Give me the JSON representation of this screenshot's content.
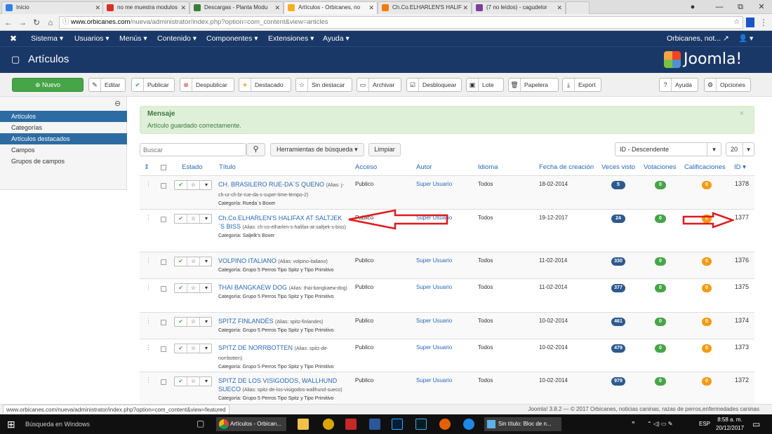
{
  "browser": {
    "tabs": [
      {
        "title": "Inicio",
        "color": "#2f80ed"
      },
      {
        "title": "no me muestra modulos",
        "color": "#d93025"
      },
      {
        "title": "Descargas - Planta Modu",
        "color": "#3a7d3a"
      },
      {
        "title": "Artículos - Orbicanes, no",
        "color": "#f6b01b",
        "active": true
      },
      {
        "title": "Ch.Co.ELHARLEN'S HALIF",
        "color": "#f57c00"
      },
      {
        "title": "(7 no leídos) - cagudelor",
        "color": "#7b3fa1"
      }
    ],
    "url_host": "www.orbicanes.com",
    "url_path": "/nueva/administrator/index.php?option=com_content&view=articles",
    "window": {
      "min": "—",
      "max": "⧉",
      "close": "✕"
    }
  },
  "joomla": {
    "menu": [
      "Sistema ▾",
      "Usuarios ▾",
      "Menús ▾",
      "Contenido ▾",
      "Componentes ▾",
      "Extensiones ▾",
      "Ayuda ▾"
    ],
    "site_name": "Orbicanes, not...",
    "user_label": "▾",
    "page_title": "Artículos",
    "brand": "Joomla!",
    "toolbar": {
      "new": "Nuevo",
      "edit": "Editar",
      "publish": "Publicar",
      "unpublish": "Despublicar",
      "feature": "Destacado",
      "unfeature": "Sin destacar",
      "archive": "Archivar",
      "checkin": "Desbloquear",
      "batch": "Lote",
      "trash": "Papelera",
      "export": "Export",
      "help": "Ayuda",
      "options": "Opciones"
    },
    "sidebar": [
      "Artículos",
      "Categorías",
      "Artículos destacados",
      "Campos",
      "Grupos de campos"
    ],
    "message": {
      "title": "Mensaje",
      "text": "Artículo guardado correctamente."
    },
    "search": {
      "placeholder": "Buscar",
      "tools": "Herramientas de búsqueda ▾",
      "clear": "Limpiar"
    },
    "sort": "ID - Descendente",
    "limit": "20",
    "columns": {
      "status": "Estado",
      "title": "Título",
      "access": "Acceso",
      "author": "Autor",
      "language": "Idioma",
      "date": "Fecha de creación",
      "hits": "Veces visto",
      "votes": "Votaciones",
      "ratings": "Calificaciones",
      "id": "ID ▾"
    },
    "articles": [
      {
        "title": "CH. BRASILERO RUE-DA´S QUENO",
        "alias": "(Alias: j-ch-ur-ch-br-rue-da-s-super-time-tempo-2)",
        "category": "Categoría: Rueda´s Boxer",
        "access": "Publico",
        "author": "Super Usuario",
        "language": "Todos",
        "date": "18-02-2014",
        "hits": "5",
        "votes": "0",
        "rating": "0",
        "id": "1378"
      },
      {
        "title": "Ch.Co.ELHARLEN'S HALIFAX AT SALTJEK `S BISS",
        "alias": "(Alias: ch-co-elharlen-s-halifax-at-saltjek-s-biss)",
        "category": "Categoría: Saljelk's Boxer",
        "access": "Publico",
        "author": "Super Usuario",
        "language": "Todos",
        "date": "19-12-2017",
        "hits": "24",
        "votes": "0",
        "rating": "0",
        "id": "1377"
      },
      {
        "title": "VOLPINO ITALIANO",
        "alias": "(Alias: volpino-italiano)",
        "category": "Categoría: Grupo 5 Perros Tipo Spitz y Tipo Primitivo",
        "access": "Publico",
        "author": "Super Usuario",
        "language": "Todos",
        "date": "11-02-2014",
        "hits": "330",
        "votes": "0",
        "rating": "0",
        "id": "1376"
      },
      {
        "title": "THAI BANGKAEW DOG",
        "alias": "(Alias: thai-bangkaew-dog)",
        "category": "Categoría: Grupo 5 Perros Tipo Spitz y Tipo Primitivo",
        "access": "Publico",
        "author": "Super Usuario",
        "language": "Todos",
        "date": "11-02-2014",
        "hits": "377",
        "votes": "0",
        "rating": "0",
        "id": "1375"
      },
      {
        "title": "SPITZ FINLANDÉS",
        "alias": "(Alias: spitz-finlandes)",
        "category": "Categoría: Grupo 5 Perros Tipo Spitz y Tipo Primitivo",
        "access": "Publico",
        "author": "Super Usuario",
        "language": "Todos",
        "date": "10-02-2014",
        "hits": "461",
        "votes": "0",
        "rating": "0",
        "id": "1374"
      },
      {
        "title": "SPITZ DE NORRBOTTEN",
        "alias": "(Alias: spitz-de-norrbotten)",
        "category": "Categoría: Grupo 5 Perros Tipo Spitz y Tipo Primitivo",
        "access": "Publico",
        "author": "Super Usuario",
        "language": "Todos",
        "date": "10-02-2014",
        "hits": "479",
        "votes": "0",
        "rating": "0",
        "id": "1373"
      },
      {
        "title": "SPITZ DE LOS VISIGODOS, WALLHUND SUECO",
        "alias": "(Alias: spitz-de-los-visigodos-wallhund-sueco)",
        "category": "Categoría: Grupo 5 Perros Tipo Spitz y Tipo Primitivo",
        "access": "Publico",
        "author": "Super Usuario",
        "language": "Todos",
        "date": "10-02-2014",
        "hits": "979",
        "votes": "0",
        "rating": "0",
        "id": "1372"
      }
    ]
  },
  "statusbar": {
    "link": "www.orbicanes.com/nueva/administrator/index.php?option=com_content&view=featured",
    "footer": "Joomla! 3.8.2 — © 2017 Orbicanes, noticias caninas, razas de perros,enfermedades caninas"
  },
  "taskbar": {
    "search": "Búsqueda en Windows",
    "apps": [
      "Artículos - Orbican...",
      "Sin título: Bloc de n..."
    ],
    "lang": "ESP",
    "time": "8:58 a. m.",
    "date": "20/12/2017"
  },
  "colors": {
    "joomla_blue": "#1a3867",
    "success": "#46a546",
    "annotation_arrow": "#e0191c"
  }
}
